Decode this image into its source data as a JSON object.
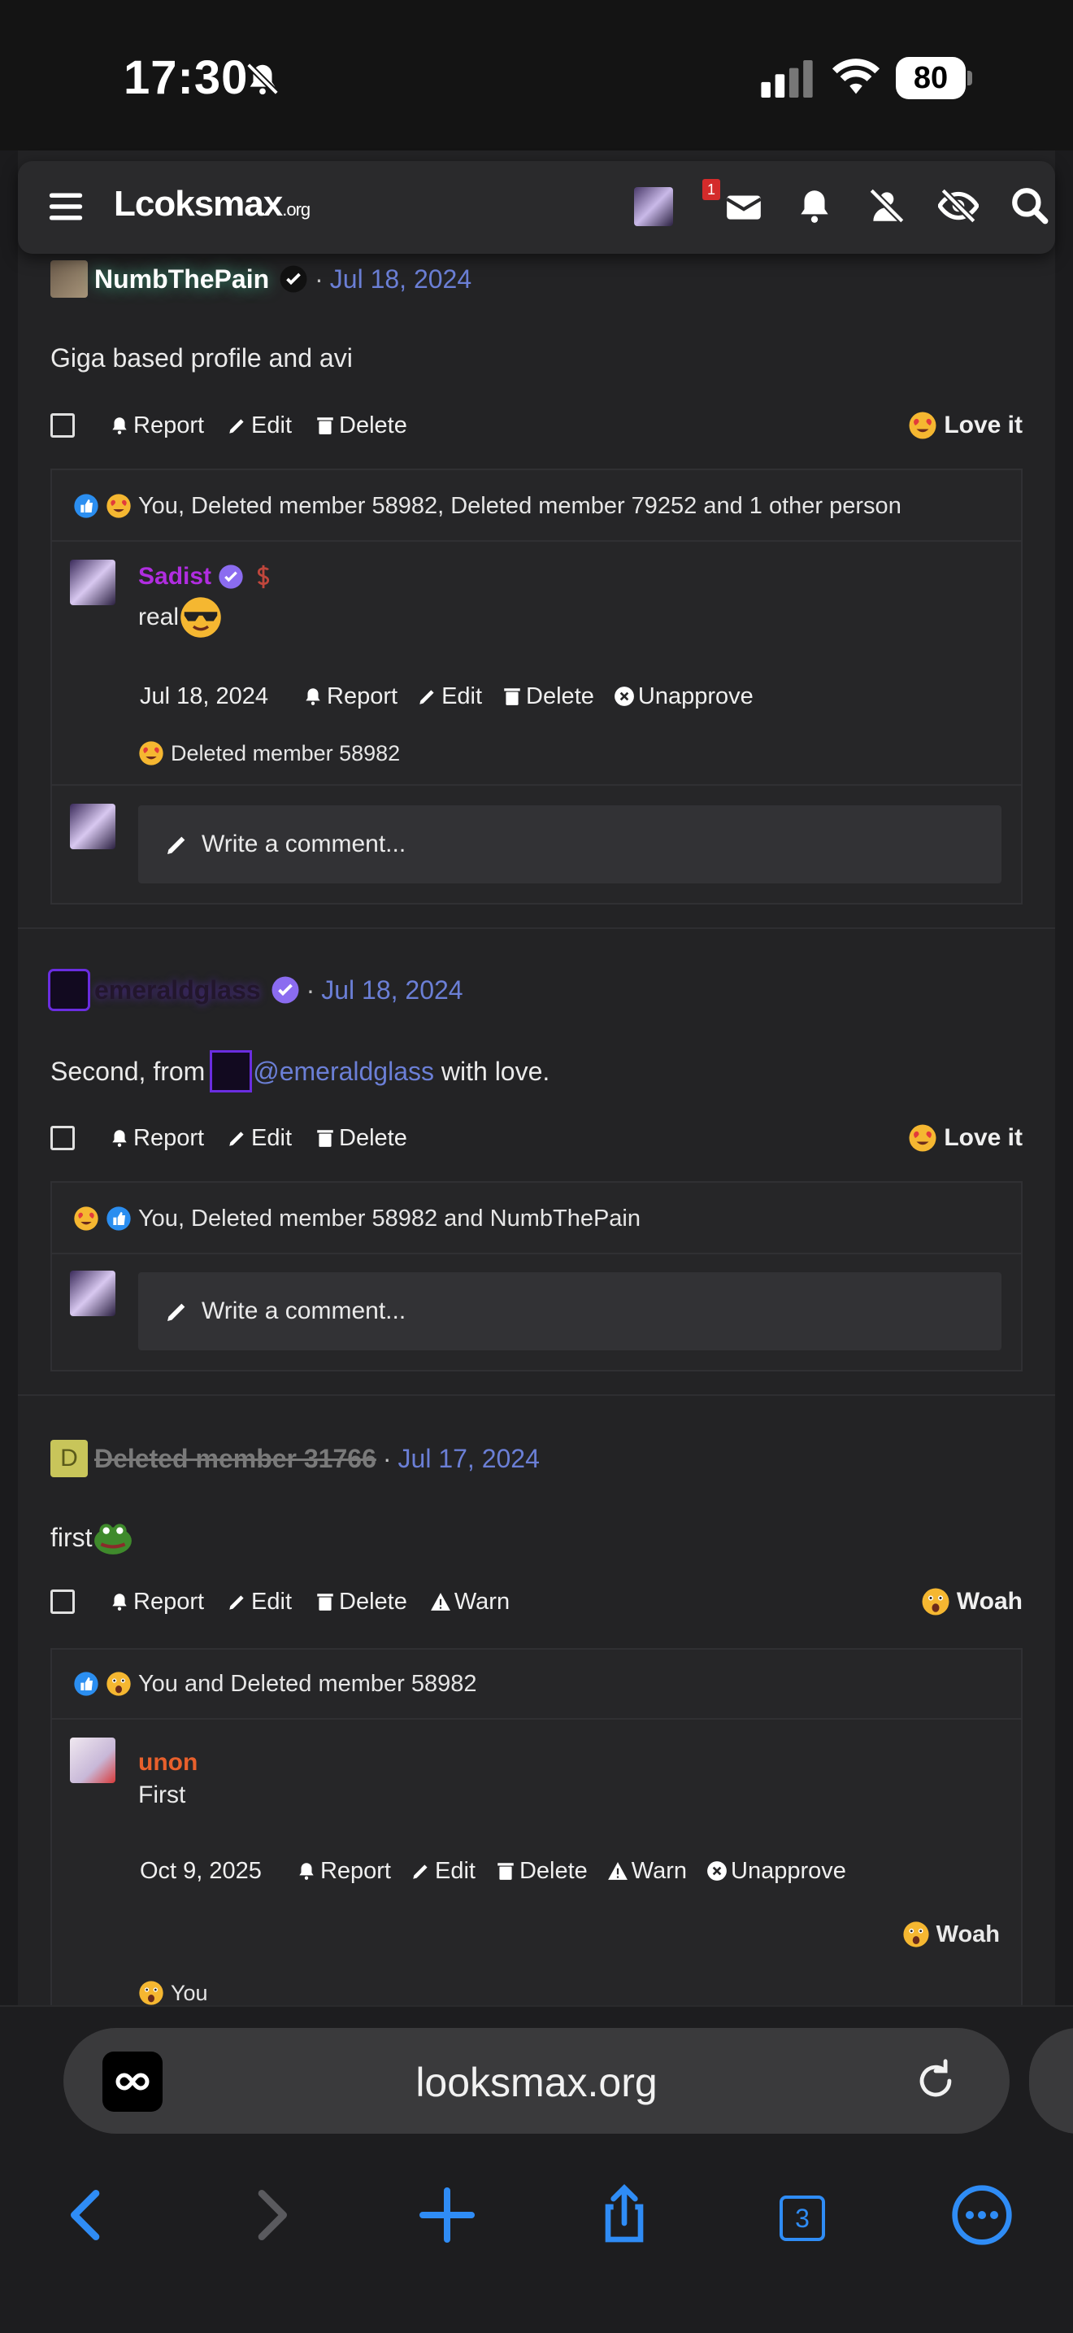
{
  "status_bar": {
    "time": "17:30",
    "battery": "80"
  },
  "header": {
    "logo": "Lcoksmax",
    "logo_suffix": ".org",
    "message_badge": "1"
  },
  "posts": [
    {
      "author": "NumbThePain",
      "date": "Jul 18, 2024",
      "body": "Giga based profile and avi",
      "actions": [
        "Report",
        "Edit",
        "Delete"
      ],
      "reaction": "Love it",
      "reactors": "You, Deleted member 58982, Deleted member 79252 and 1 other person",
      "comment": {
        "author": "Sadist",
        "text": "real",
        "date": "Jul 18, 2024",
        "actions": [
          "Report",
          "Edit",
          "Delete",
          "Unapprove"
        ],
        "reactors": "Deleted member 58982"
      },
      "comment_placeholder": "Write a comment..."
    },
    {
      "author": "emeraldglass",
      "date": "Jul 18, 2024",
      "body_prefix": "Second, from ",
      "body_mention": "@emeraldglass",
      "body_suffix": " with love.",
      "actions": [
        "Report",
        "Edit",
        "Delete"
      ],
      "reaction": "Love it",
      "reactors": "You, Deleted member 58982 and NumbThePain",
      "comment_placeholder": "Write a comment..."
    },
    {
      "avatar_letter": "D",
      "author": "Deleted member 31766",
      "date": "Jul 17, 2024",
      "body": "first",
      "actions": [
        "Report",
        "Edit",
        "Delete",
        "Warn"
      ],
      "reaction": "Woah",
      "reactors": "You and Deleted member 58982",
      "comment": {
        "author": "unon",
        "text": "First",
        "date": "Oct 9, 2025",
        "actions": [
          "Report",
          "Edit",
          "Delete",
          "Warn",
          "Unapprove"
        ],
        "reaction": "Woah",
        "reactors": "You"
      }
    }
  ],
  "browser": {
    "url": "looksmax.org",
    "tab_count": "3"
  },
  "colors": {
    "link": "#6b7fd6",
    "accent": "#2f8cf5",
    "sadist": "#b02de0",
    "unon": "#e8602c"
  }
}
